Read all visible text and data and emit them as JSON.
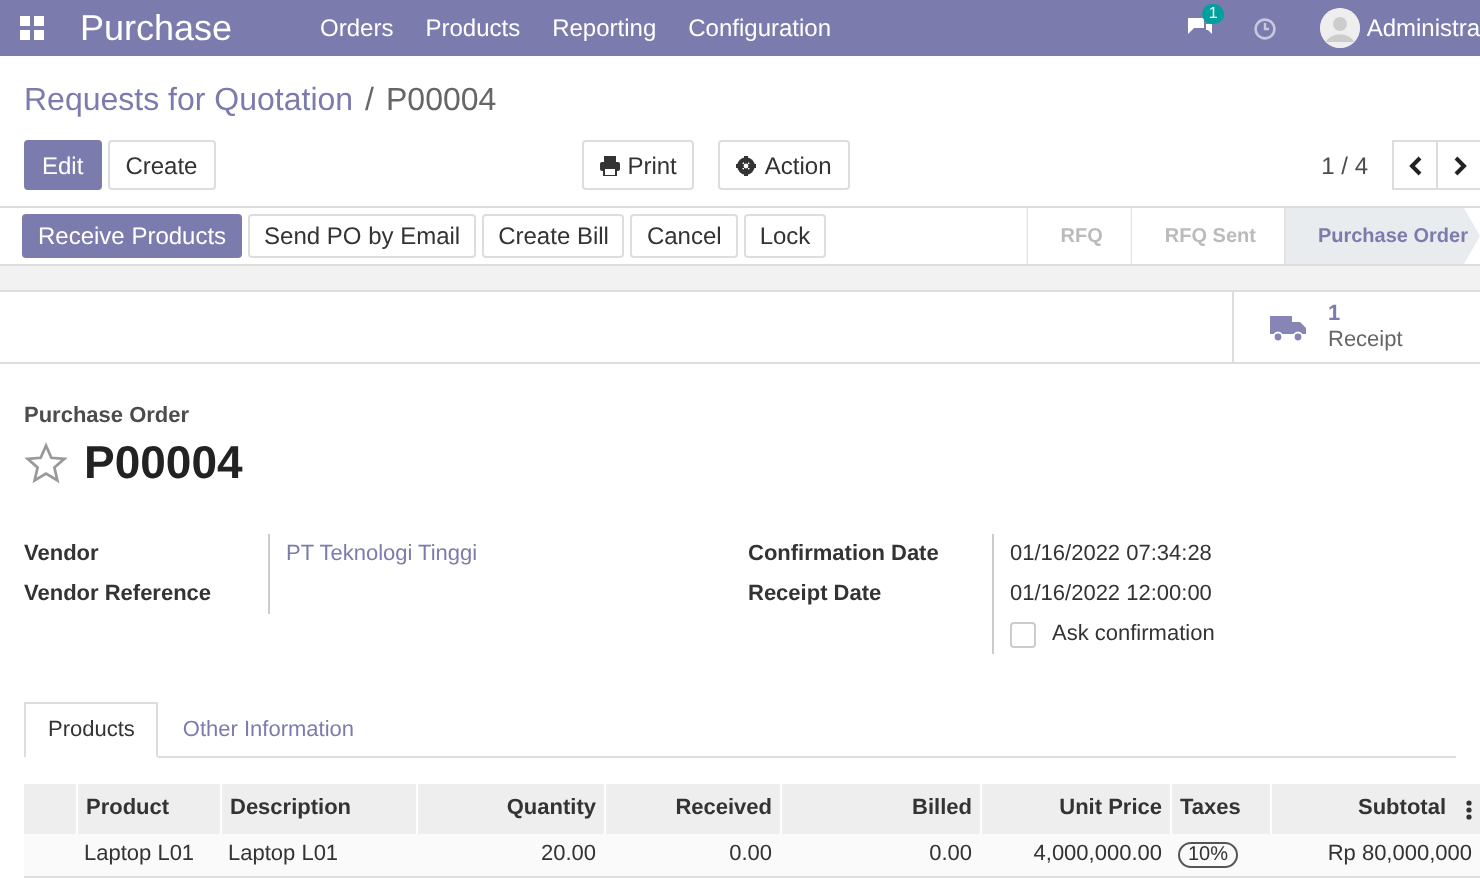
{
  "navbar": {
    "app_title": "Purchase",
    "menu": [
      "Orders",
      "Products",
      "Reporting",
      "Configuration"
    ],
    "message_count": "1",
    "user": "Administra"
  },
  "breadcrumb": {
    "parent": "Requests for Quotation",
    "separator": "/",
    "current": "P00004"
  },
  "control_buttons": [
    {
      "label": "Edit",
      "kind": "primary"
    },
    {
      "label": "Create",
      "kind": "secondary"
    }
  ],
  "action_buttons": [
    {
      "label": "Print",
      "kind": "print"
    },
    {
      "label": "Action",
      "kind": "gear"
    }
  ],
  "pager": {
    "text": "1 / 4"
  },
  "header_buttons": [
    {
      "label": "Receive Products",
      "kind": "primary"
    },
    {
      "label": "Send PO by Email",
      "kind": "secondary"
    },
    {
      "label": "Create Bill",
      "kind": "secondary"
    },
    {
      "label": "Cancel",
      "kind": "secondary"
    },
    {
      "label": "Lock",
      "kind": "secondary"
    }
  ],
  "stages": [
    {
      "label": "RFQ",
      "selected": false
    },
    {
      "label": "RFQ Sent",
      "selected": false
    },
    {
      "label": "Purchase Order",
      "selected": true
    }
  ],
  "smart_button": {
    "count": "1",
    "label": "Receipt"
  },
  "form": {
    "subtitle": "Purchase Order",
    "favorite": false,
    "name": "P00004",
    "left_fields": [
      {
        "label": "Vendor",
        "value": "PT Teknologi Tinggi",
        "kind": "link"
      },
      {
        "label": "Vendor Reference",
        "kind": "text"
      }
    ],
    "right_fields": [
      {
        "label": "Confirmation Date",
        "value": "01/16/2022 07:34:28",
        "kind": "text"
      },
      {
        "label": "Receipt Date",
        "value": "01/16/2022 12:00:00",
        "kind": "text"
      },
      {
        "label": "Ask confirmation",
        "checked": false,
        "kind": "checkbox"
      }
    ]
  },
  "tabs": [
    {
      "label": "Products",
      "selected": true
    },
    {
      "label": "Other Information",
      "selected": false
    }
  ],
  "table": {
    "columns": [
      "Product",
      "Description",
      "Quantity",
      "Received",
      "Billed",
      "Unit Price",
      "Taxes",
      "Subtotal"
    ],
    "rows": [
      {
        "cells": [
          "Laptop L01",
          "Laptop L01",
          "20.00",
          "0.00",
          "0.00",
          "4,000,000.00"
        ],
        "tax": "10%",
        "subtotal": "Rp 80,000,000"
      }
    ]
  }
}
